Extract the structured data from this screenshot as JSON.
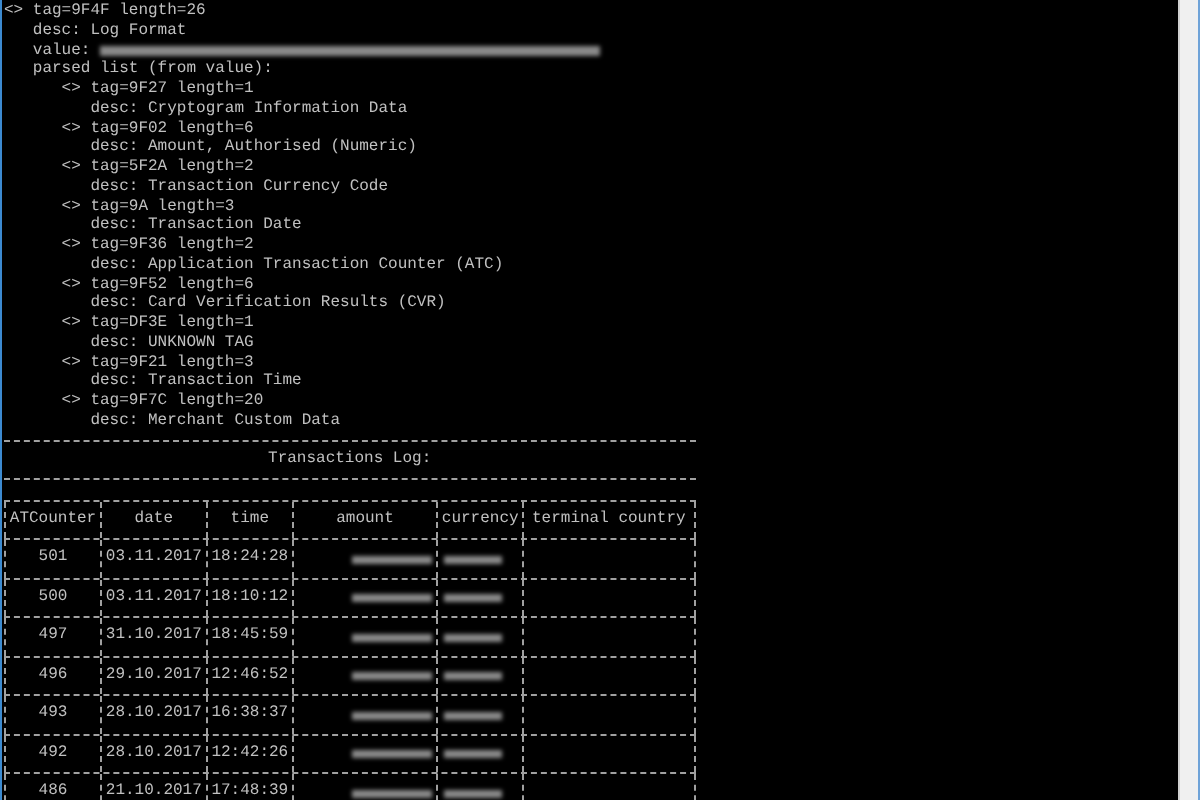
{
  "root": {
    "line": "<> tag=9F4F length=26",
    "desc": "desc: Log Format",
    "value_label": "value:",
    "value_redacted": true,
    "parsed_label": "parsed list (from value):",
    "children": [
      {
        "line": "<> tag=9F27 length=1",
        "desc": "desc: Cryptogram Information Data"
      },
      {
        "line": "<> tag=9F02 length=6",
        "desc": "desc: Amount, Authorised (Numeric)"
      },
      {
        "line": "<> tag=5F2A length=2",
        "desc": "desc: Transaction Currency Code"
      },
      {
        "line": "<> tag=9A length=3",
        "desc": "desc: Transaction Date"
      },
      {
        "line": "<> tag=9F36 length=2",
        "desc": "desc: Application Transaction Counter (ATC)"
      },
      {
        "line": "<> tag=9F52 length=6",
        "desc": "desc: Card Verification Results (CVR)"
      },
      {
        "line": "<> tag=DF3E length=1",
        "desc": "desc: UNKNOWN TAG"
      },
      {
        "line": "<> tag=9F21 length=3",
        "desc": "desc: Transaction Time"
      },
      {
        "line": "<> tag=9F7C length=20",
        "desc": "desc: Merchant Custom Data"
      }
    ]
  },
  "log_title": "Transactions Log:",
  "table": {
    "columns": [
      "ATCounter",
      "date",
      "time",
      "amount",
      "currency",
      "terminal country"
    ],
    "rows": [
      {
        "atc": "501",
        "date": "03.11.2017",
        "time": "18:24:28",
        "amount_redacted": true,
        "currency_redacted": true
      },
      {
        "atc": "500",
        "date": "03.11.2017",
        "time": "18:10:12",
        "amount_redacted": true,
        "currency_redacted": true
      },
      {
        "atc": "497",
        "date": "31.10.2017",
        "time": "18:45:59",
        "amount_redacted": true,
        "currency_redacted": true
      },
      {
        "atc": "496",
        "date": "29.10.2017",
        "time": "12:46:52",
        "amount_redacted": true,
        "currency_redacted": true
      },
      {
        "atc": "493",
        "date": "28.10.2017",
        "time": "16:38:37",
        "amount_redacted": true,
        "currency_redacted": true
      },
      {
        "atc": "492",
        "date": "28.10.2017",
        "time": "12:42:26",
        "amount_redacted": true,
        "currency_redacted": true
      },
      {
        "atc": "486",
        "date": "21.10.2017",
        "time": "17:48:39",
        "amount_redacted": true,
        "currency_redacted": true
      }
    ]
  }
}
